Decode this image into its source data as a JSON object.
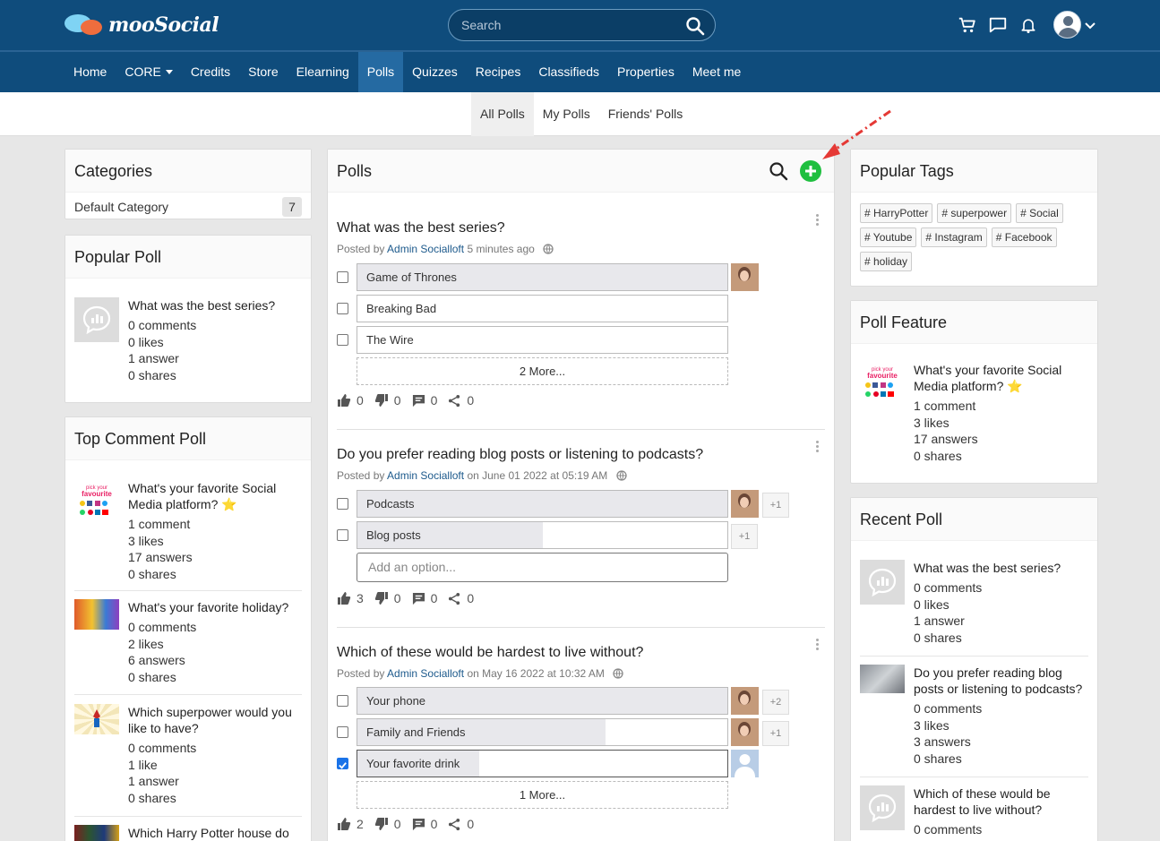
{
  "app": {
    "name": "mooSocial"
  },
  "search": {
    "placeholder": "Search"
  },
  "nav": [
    {
      "label": "Home"
    },
    {
      "label": "CORE"
    },
    {
      "label": "Credits"
    },
    {
      "label": "Store"
    },
    {
      "label": "Elearning"
    },
    {
      "label": "Polls"
    },
    {
      "label": "Quizzes"
    },
    {
      "label": "Recipes"
    },
    {
      "label": "Classifieds"
    },
    {
      "label": "Properties"
    },
    {
      "label": "Meet me"
    }
  ],
  "subtabs": [
    {
      "label": "All Polls"
    },
    {
      "label": "My Polls"
    },
    {
      "label": "Friends' Polls"
    }
  ],
  "categories": {
    "title": "Categories",
    "items": [
      {
        "name": "Default Category",
        "count": "7"
      }
    ]
  },
  "popular_poll": {
    "title": "Popular Poll",
    "items": [
      {
        "title": "What was the best series?",
        "comments": "0 comments",
        "likes": "0 likes",
        "answers": "1 answer",
        "shares": "0 shares"
      }
    ]
  },
  "top_comment_poll": {
    "title": "Top Comment Poll",
    "items": [
      {
        "title": "What's your favorite Social Media platform? ⭐",
        "comments": "1 comment",
        "likes": "3 likes",
        "answers": "17 answers",
        "shares": "0 shares"
      },
      {
        "title": "What's your favorite holiday?",
        "comments": "0 comments",
        "likes": "2 likes",
        "answers": "6 answers",
        "shares": "0 shares"
      },
      {
        "title": "Which superpower would you like to have?",
        "comments": "0 comments",
        "likes": "1 like",
        "answers": "1 answer",
        "shares": "0 shares"
      },
      {
        "title": "Which Harry Potter house do"
      }
    ]
  },
  "polls_main": {
    "title": "Polls",
    "posted_by": "Posted by",
    "polls": [
      {
        "question": "What was the best series?",
        "author": "Admin Socialloft",
        "time": "5 minutes ago",
        "options": [
          {
            "label": "Game of Thrones",
            "fill": 1.0,
            "checked": false
          },
          {
            "label": "Breaking Bad",
            "fill": 0,
            "checked": false
          },
          {
            "label": "The Wire",
            "fill": 0,
            "checked": false
          }
        ],
        "more": "2 More...",
        "likes": "0",
        "dislikes": "0",
        "comments": "0",
        "shares": "0"
      },
      {
        "question": "Do you prefer reading blog posts or listening to podcasts?",
        "author": "Admin Socialloft",
        "time": "on June 01 2022 at 05:19 AM",
        "options": [
          {
            "label": "Podcasts",
            "fill": 1.0,
            "checked": false,
            "extra": "+1"
          },
          {
            "label": "Blog posts",
            "fill": 0.5,
            "checked": false,
            "extra": "+1"
          }
        ],
        "add_option_placeholder": "Add an option...",
        "likes": "3",
        "dislikes": "0",
        "comments": "0",
        "shares": "0"
      },
      {
        "question": "Which of these would be hardest to live without?",
        "author": "Admin Socialloft",
        "time": "on May 16 2022 at 10:32 AM",
        "options": [
          {
            "label": "Your phone",
            "fill": 1.0,
            "checked": false,
            "extra": "+2"
          },
          {
            "label": "Family and Friends",
            "fill": 0.67,
            "checked": false,
            "extra": "+1"
          },
          {
            "label": "Your favorite drink",
            "fill": 0.33,
            "checked": true
          }
        ],
        "more": "1 More...",
        "likes": "2",
        "dislikes": "0",
        "comments": "0",
        "shares": "0"
      }
    ]
  },
  "popular_tags": {
    "title": "Popular Tags",
    "tags": [
      "# HarryPotter",
      "# superpower",
      "# Social",
      "# Youtube",
      "# Instagram",
      "# Facebook",
      "# holiday"
    ]
  },
  "poll_feature": {
    "title": "Poll Feature",
    "items": [
      {
        "title": "What's your favorite Social Media platform? ⭐",
        "comments": "1 comment",
        "likes": "3 likes",
        "answers": "17 answers",
        "shares": "0 shares"
      }
    ]
  },
  "recent_poll": {
    "title": "Recent Poll",
    "items": [
      {
        "title": "What was the best series?",
        "comments": "0 comments",
        "likes": "0 likes",
        "answers": "1 answer",
        "shares": "0 shares"
      },
      {
        "title": "Do you prefer reading blog posts or listening to podcasts?",
        "comments": "0 comments",
        "likes": "3 likes",
        "answers": "3 answers",
        "shares": "0 shares"
      },
      {
        "title": "Which of these would be hardest to live without?",
        "comments": "0 comments"
      }
    ]
  },
  "colors": {
    "header": "#0f4c7c",
    "active_nav": "#256aa2",
    "add_button": "#1fbf3f",
    "arrow": "#e53935"
  }
}
